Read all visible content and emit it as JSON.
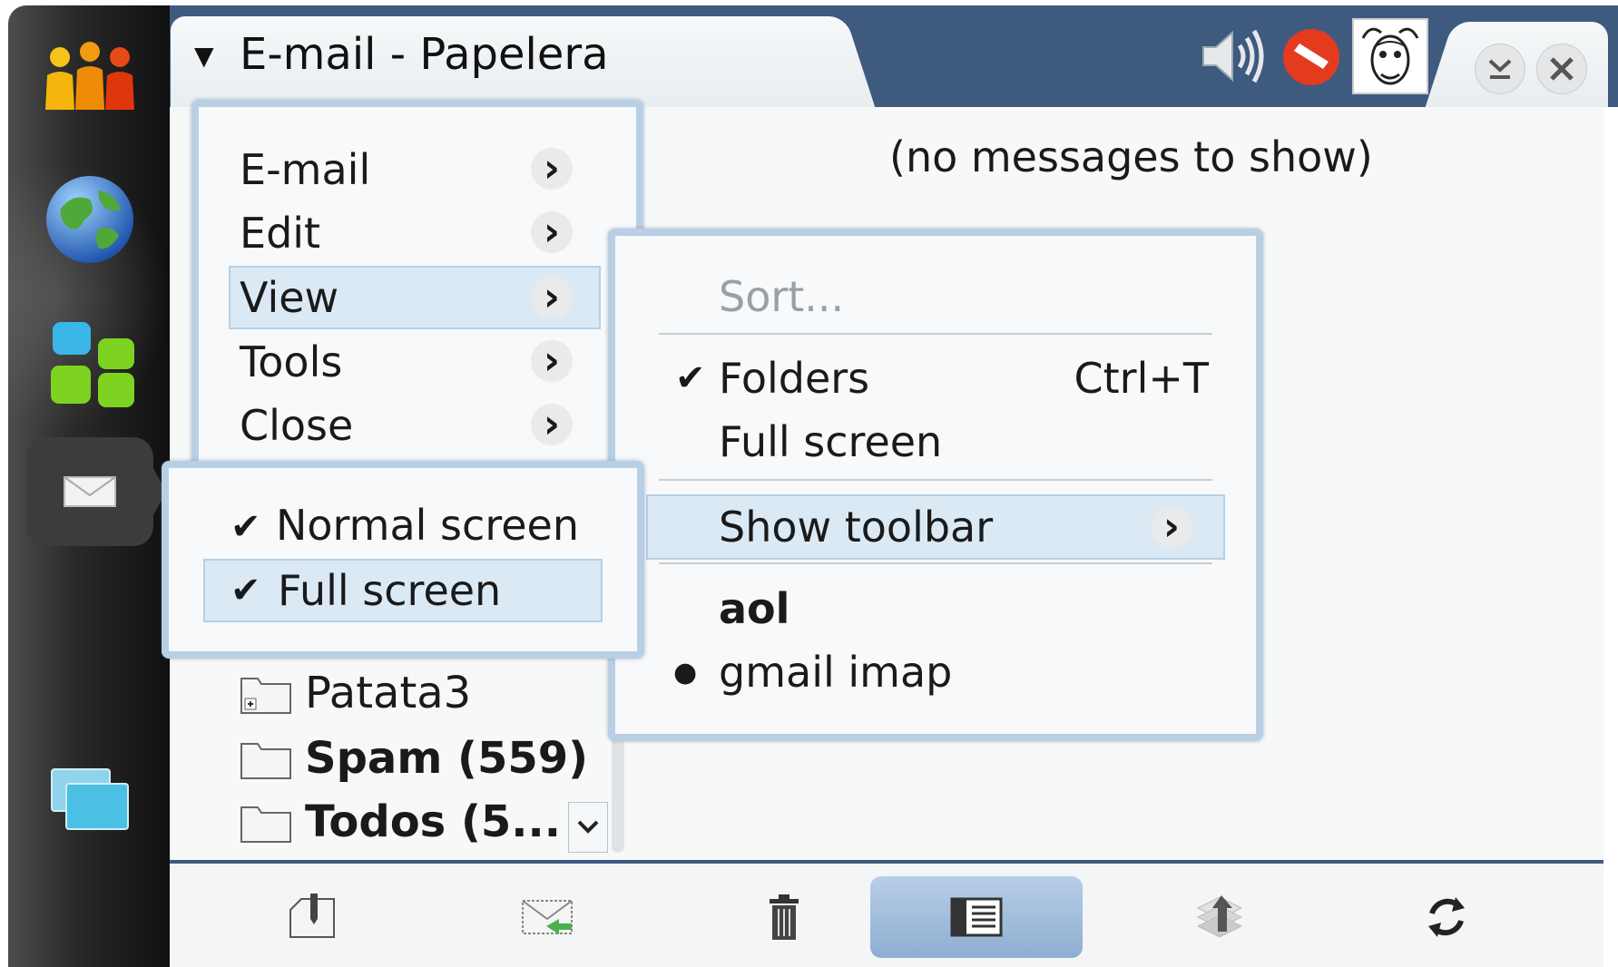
{
  "window": {
    "title": "E-mail - Papelera",
    "title_caret": "▼"
  },
  "content": {
    "empty_text": "(no messages to show)"
  },
  "folders": [
    {
      "label": "Patata3",
      "bold": false
    },
    {
      "label": "Spam (559)",
      "bold": true
    },
    {
      "label": "Todos (5...",
      "bold": true
    }
  ],
  "main_menu": {
    "items": [
      {
        "label": "E-mail"
      },
      {
        "label": "Edit"
      },
      {
        "label": "View"
      },
      {
        "label": "Tools"
      },
      {
        "label": "Close"
      }
    ]
  },
  "view_menu": {
    "sort_label": "Sort...",
    "folders_label": "Folders",
    "folders_shortcut": "Ctrl+T",
    "fullscreen_label": "Full screen",
    "show_toolbar_label": "Show toolbar",
    "accounts_header": "aol",
    "account_item": "gmail imap"
  },
  "toolbar_menu": {
    "normal_label": "Normal screen",
    "full_label": "Full screen"
  },
  "glyphs": {
    "check": "✔",
    "bullet": "●",
    "chevron": "›"
  },
  "colors": {
    "title_bar": "#3f5a7f",
    "menu_border": "#b9cfe3",
    "highlight": "#dbe9f5",
    "toolbar_active": "#8eaed2"
  },
  "icons": {
    "task_contacts": "contacts-icon",
    "task_web": "globe-icon",
    "task_apps": "apps-icon",
    "task_email": "envelope-icon",
    "task_switcher": "windows-icon",
    "toolbar": [
      "new-message-icon",
      "send-receive-icon",
      "delete-icon",
      "folder-view-icon",
      "move-to-icon",
      "refresh-icon"
    ]
  }
}
